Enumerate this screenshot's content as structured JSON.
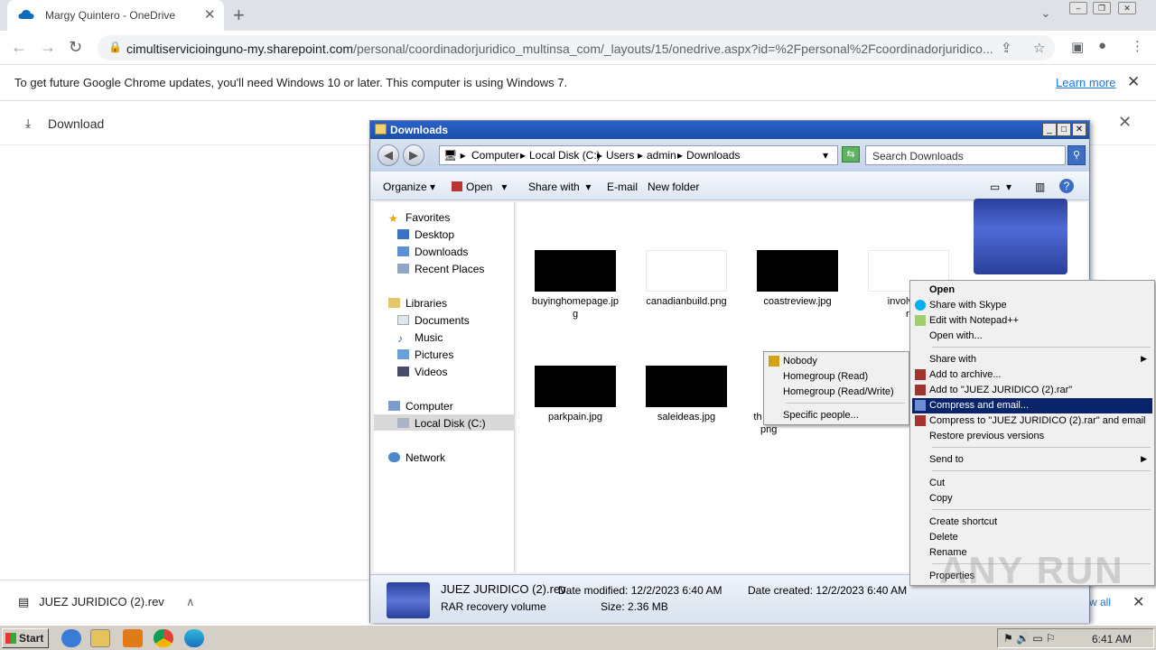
{
  "browser": {
    "tab_title": "Margy Quintero - OneDrive",
    "url_host": "cimultiservicioinguno-my.sharepoint.com",
    "url_path": "/personal/coordinadorjuridico_multinsa_com/_layouts/15/onedrive.aspx?id=%2Fpersonal%2Fcoordinadorjuridico...",
    "infobar_message": "To get future Google Chrome updates, you'll need Windows 10 or later. This computer is using Windows 7.",
    "learn_more": "Learn more"
  },
  "onedrive": {
    "download_label": "Download"
  },
  "download_shelf": {
    "item_name": "JUEZ JURIDICO (2).rev",
    "show_all": "w all"
  },
  "explorer": {
    "title": "Downloads",
    "breadcrumb": [
      "Computer",
      "Local Disk (C:)",
      "Users",
      "admin",
      "Downloads"
    ],
    "search_placeholder": "Search Downloads",
    "commands": {
      "organize": "Organize",
      "open": "Open",
      "share_with": "Share with",
      "email": "E-mail",
      "new_folder": "New folder"
    },
    "nav": {
      "favorites": "Favorites",
      "desktop": "Desktop",
      "downloads": "Downloads",
      "recent_places": "Recent Places",
      "libraries": "Libraries",
      "documents": "Documents",
      "music": "Music",
      "pictures": "Pictures",
      "videos": "Videos",
      "computer": "Computer",
      "local_disk": "Local Disk (C:)",
      "network": "Network"
    },
    "files": {
      "f1_line1": "buyinghomepage.jp",
      "f1_line2": "g",
      "f2": "canadianbuild.png",
      "f3": "coastreview.jpg",
      "f4_line1": "involvedri",
      "f4_line2": "n",
      "f5": "parkpain.jpg",
      "f6": "saleideas.jpg",
      "f7_line1": "th",
      "f7_line2": "png"
    },
    "status": {
      "name": "JUEZ JURIDICO (2).rev",
      "type": "RAR recovery volume",
      "modified": "Date modified: 12/2/2023 6:40 AM",
      "created": "Date created: 12/2/2023 6:40 AM",
      "size": "Size: 2.36 MB"
    }
  },
  "share_submenu": {
    "nobody": "Nobody",
    "homegroup_read": "Homegroup (Read)",
    "homegroup_rw": "Homegroup (Read/Write)",
    "specific_people": "Specific people..."
  },
  "context_menu": {
    "open": "Open",
    "share_skype": "Share with Skype",
    "edit_notepad": "Edit with Notepad++",
    "open_with": "Open with...",
    "share_with": "Share with",
    "add_archive": "Add to archive...",
    "add_rar": "Add to \"JUEZ JURIDICO (2).rar\"",
    "compress_email": "Compress and email...",
    "compress_rar_email": "Compress to \"JUEZ JURIDICO (2).rar\" and email",
    "restore": "Restore previous versions",
    "send_to": "Send to",
    "cut": "Cut",
    "copy": "Copy",
    "create_shortcut": "Create shortcut",
    "delete": "Delete",
    "rename": "Rename",
    "properties": "Properties"
  },
  "taskbar": {
    "start": "Start",
    "clock": "6:41 AM"
  },
  "watermark": "ANY RUN",
  "colors": {
    "menu_selection": "#0a246a",
    "link": "#1a73e8",
    "title_bar": "#1d4fa8"
  }
}
